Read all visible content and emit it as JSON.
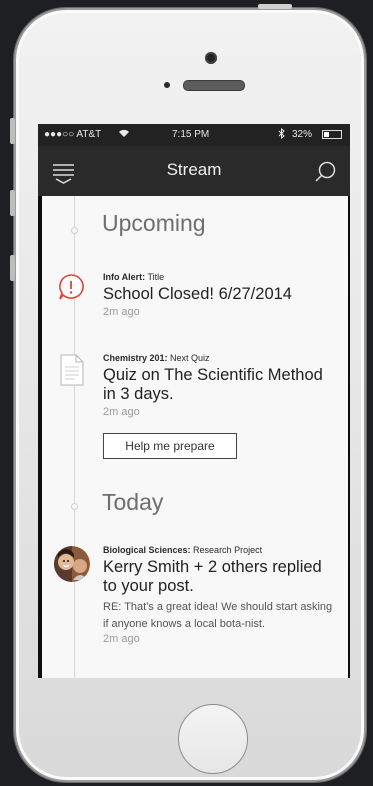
{
  "status_bar": {
    "carrier": "●●●○○ AT&T",
    "wifi_icon": "wifi-icon",
    "time": "7:15 PM",
    "bluetooth_icon": "bluetooth-icon",
    "battery": "32%",
    "battery_level": 0.32
  },
  "nav": {
    "title": "Stream",
    "menu_icon": "menu-icon",
    "search_icon": "search-icon"
  },
  "sections": [
    {
      "title": "Upcoming",
      "items": [
        {
          "icon": "alert-icon",
          "category": "Info Alert:",
          "subtitle": "Title",
          "headline": "School Closed! 6/27/2014",
          "time_ago": "2m ago"
        },
        {
          "icon": "document-icon",
          "category": "Chemistry 201:",
          "subtitle": "Next Quiz",
          "headline": "Quiz on The Scientific Method in 3 days.",
          "time_ago": "2m ago",
          "action_label": "Help me prepare"
        }
      ]
    },
    {
      "title": "Today",
      "items": [
        {
          "icon": "avatar",
          "category": "Biological Sciences:",
          "subtitle": "Research Project",
          "headline": "Kerry Smith + 2 others replied to your post.",
          "body": "RE: That's a great idea! We should start asking if anyone knows a local bota-nist.",
          "time_ago": "2m ago"
        }
      ]
    }
  ],
  "colors": {
    "nav_bg": "#2a2a2a",
    "content_bg": "#f8f8f8",
    "alert_red": "#e0413a"
  }
}
